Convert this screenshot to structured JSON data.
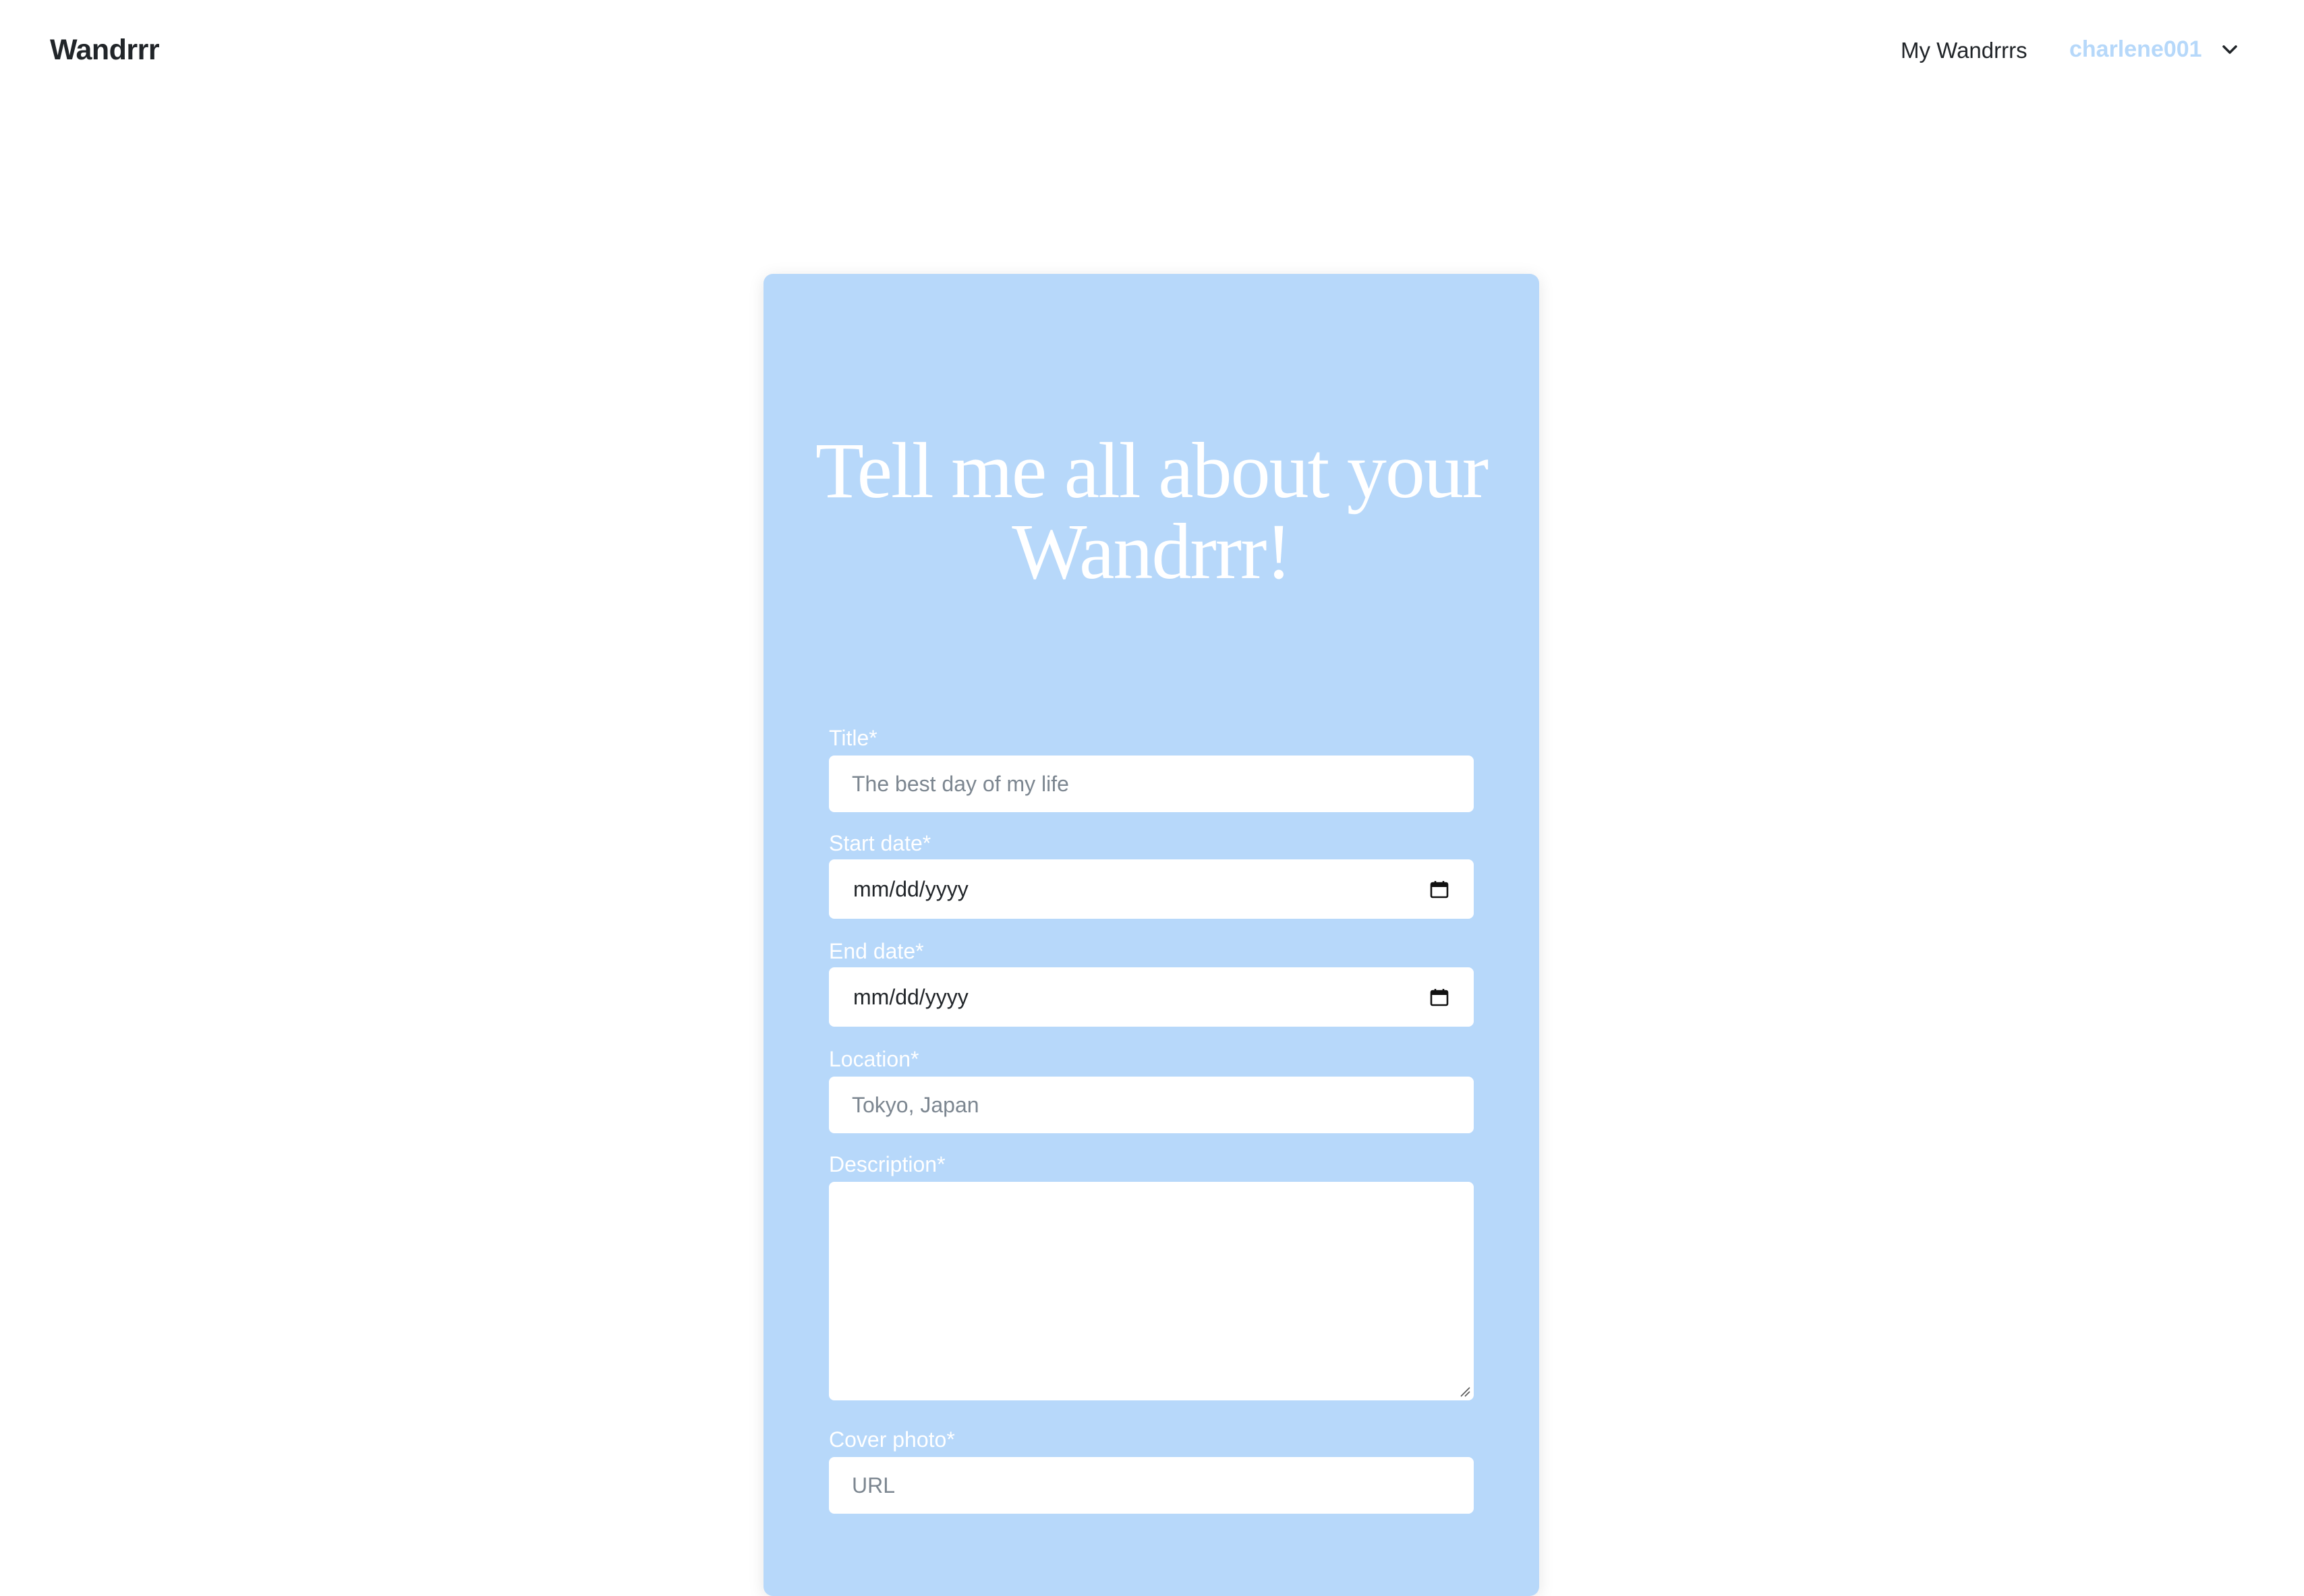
{
  "navbar": {
    "brand": "Wandrrr",
    "my_wandrrrs_link": "My Wandrrrs",
    "username": "charlene001",
    "dropdown_icon": "chevron-down-icon"
  },
  "form": {
    "heading": "Tell me all about your Wandrrr!",
    "fields": {
      "title": {
        "label": "Title*",
        "placeholder": "The best day of my life",
        "value": ""
      },
      "start_date": {
        "label": "Start date*",
        "value": "mm/dd/yyyy",
        "icon": "calendar-icon"
      },
      "end_date": {
        "label": "End date*",
        "value": "mm/dd/yyyy",
        "icon": "calendar-icon"
      },
      "location": {
        "label": "Location*",
        "placeholder": "Tokyo, Japan",
        "value": ""
      },
      "description": {
        "label": "Description*",
        "value": ""
      },
      "cover_photo": {
        "label": "Cover photo*",
        "placeholder": "URL",
        "value": ""
      }
    }
  },
  "colors": {
    "card_background": "#b7d8fa",
    "username": "#b6d8fa",
    "label_text": "#ffffff",
    "heading_text": "#ffffff"
  }
}
